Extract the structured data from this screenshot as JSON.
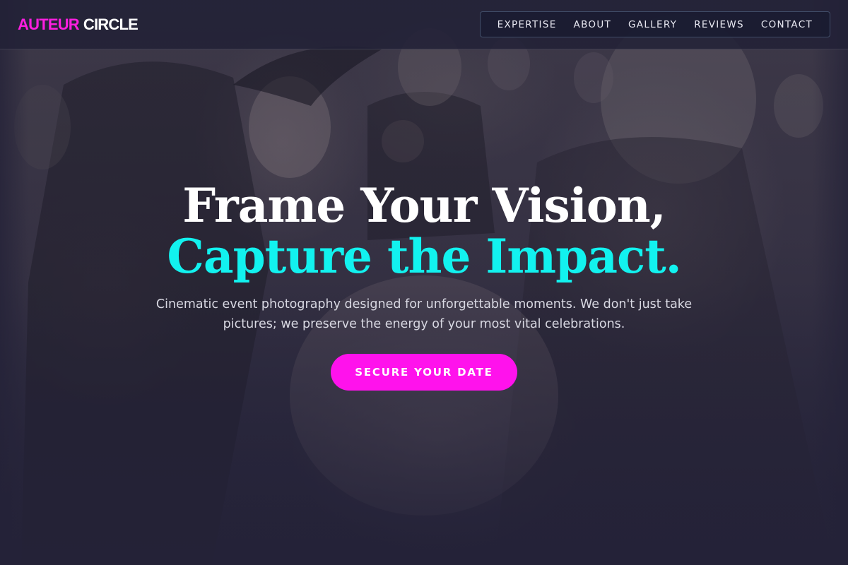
{
  "header": {
    "logo_accent": "AUTEUR",
    "logo_main": "CIRCLE",
    "nav": [
      {
        "label": "EXPERTISE"
      },
      {
        "label": "ABOUT"
      },
      {
        "label": "GALLERY"
      },
      {
        "label": "REVIEWS"
      },
      {
        "label": "CONTACT"
      }
    ]
  },
  "hero": {
    "headline_line1": "Frame Your Vision,",
    "headline_line2": "Capture the Impact.",
    "subtitle": "Cinematic event photography designed for unforgettable moments. We don't just take pictures; we preserve the energy of your most vital celebrations.",
    "cta_label": "SECURE YOUR DATE"
  },
  "colors": {
    "accent_magenta": "#ff12ec",
    "accent_cyan": "#12f2ef",
    "background": "#24223a"
  }
}
